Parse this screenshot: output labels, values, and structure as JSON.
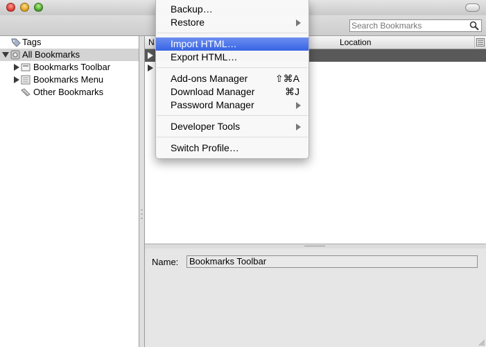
{
  "toolbar": {
    "search_placeholder": "Search Bookmarks"
  },
  "sidebar": {
    "items": [
      {
        "label": "Tags"
      },
      {
        "label": "All Bookmarks"
      },
      {
        "label": "Bookmarks Toolbar"
      },
      {
        "label": "Bookmarks Menu"
      },
      {
        "label": "Other Bookmarks"
      }
    ]
  },
  "content": {
    "columns": [
      {
        "label": "N"
      },
      {
        "label": "Location"
      }
    ]
  },
  "details": {
    "name_label": "Name:",
    "name_value": "Bookmarks Toolbar"
  },
  "menu": {
    "items": [
      {
        "label": "Backup…"
      },
      {
        "label": "Restore",
        "submenu": true
      },
      {
        "label": "Import HTML…",
        "highlighted": true
      },
      {
        "label": "Export HTML…"
      },
      {
        "label": "Add-ons Manager",
        "shortcut": "⇧⌘A"
      },
      {
        "label": "Download Manager",
        "shortcut": "⌘J"
      },
      {
        "label": "Password Manager",
        "submenu": true
      },
      {
        "label": "Developer Tools",
        "submenu": true
      },
      {
        "label": "Switch Profile…"
      }
    ]
  },
  "colors": {
    "menu_highlight": "#3f6fe6",
    "selected_row": "#595959"
  }
}
